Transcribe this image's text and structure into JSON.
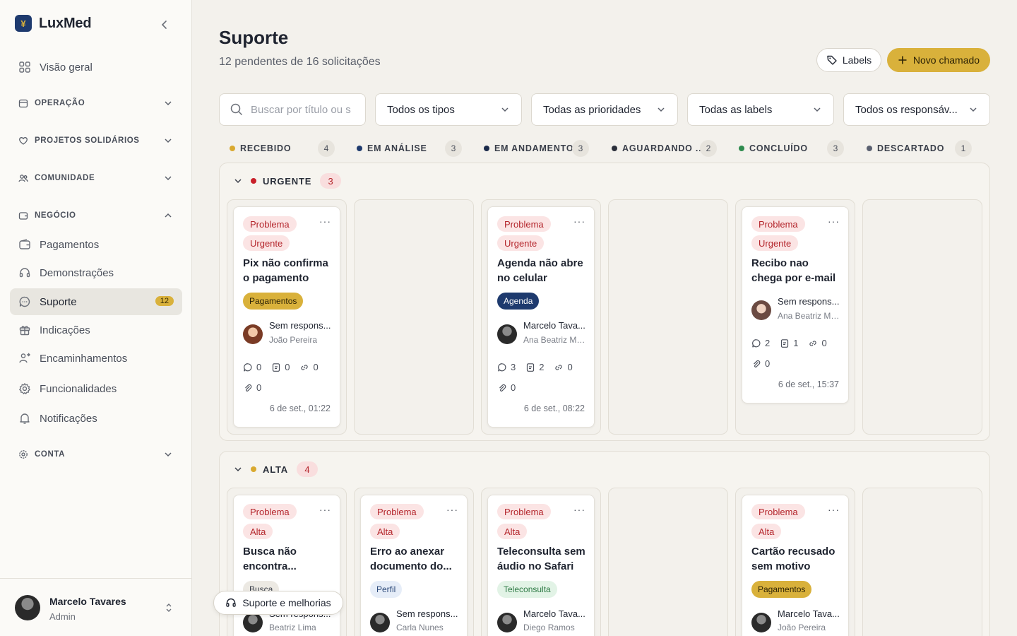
{
  "app": {
    "name": "LuxMed"
  },
  "sidebar": {
    "items": [
      {
        "label": "Visão geral"
      },
      {
        "label": "Pagamentos"
      },
      {
        "label": "Demonstrações"
      },
      {
        "label": "Suporte",
        "badge": "12"
      },
      {
        "label": "Indicações"
      },
      {
        "label": "Encaminhamentos"
      },
      {
        "label": "Funcionalidades"
      },
      {
        "label": "Notificações"
      }
    ],
    "sections": [
      {
        "label": "OPERAÇÃO"
      },
      {
        "label": "PROJETOS SOLIDÁRIOS"
      },
      {
        "label": "COMUNIDADE"
      },
      {
        "label": "NEGÓCIO"
      },
      {
        "label": "CONTA"
      }
    ],
    "user": {
      "name": "Marcelo Tavares",
      "role": "Admin"
    }
  },
  "header": {
    "title": "Suporte",
    "subtitle": "12 pendentes de 16 solicitações",
    "labels_button": "Labels",
    "new_button": "Novo chamado"
  },
  "filters": {
    "search_placeholder": "Buscar por título ou s",
    "type": "Todos os tipos",
    "priority": "Todas as prioridades",
    "labels": "Todas as labels",
    "assignee": "Todos os responsáv..."
  },
  "columns": [
    {
      "label": "RECEBIDO",
      "count": "4",
      "color": "#d9a92f"
    },
    {
      "label": "EM ANÁLISE",
      "count": "3",
      "color": "#1e3a6e"
    },
    {
      "label": "EM ANDAMENTO",
      "count": "3",
      "color": "#1a2a4a"
    },
    {
      "label": "AGUARDANDO ...",
      "count": "2",
      "color": "#2a2f3a"
    },
    {
      "label": "CONCLUÍDO",
      "count": "3",
      "color": "#2e8b4e"
    },
    {
      "label": "DESCARTADO",
      "count": "1",
      "color": "#5a6070"
    }
  ],
  "groups": [
    {
      "label": "URGENTE",
      "count": "3",
      "color": "#c8202a"
    },
    {
      "label": "ALTA",
      "count": "4",
      "color": "#d9a92f"
    }
  ],
  "cards": {
    "u1": {
      "type": "Problema",
      "priority": "Urgente",
      "title1": "Pix não confirma",
      "title2": "o pagamento",
      "label": "Pagamentos",
      "assignee": "Sem respons...",
      "reporter": "João Pereira",
      "comments": "0",
      "docs": "0",
      "links": "0",
      "attachments": "0",
      "date": "6 de set., 01:22"
    },
    "u2": {
      "type": "Problema",
      "priority": "Urgente",
      "title1": "Agenda não abre",
      "title2": "no celular",
      "label": "Agenda",
      "assignee": "Marcelo Tava...",
      "reporter": "Ana Beatriz Mo...",
      "comments": "3",
      "docs": "2",
      "links": "0",
      "attachments": "0",
      "date": "6 de set., 08:22"
    },
    "u3": {
      "type": "Problema",
      "priority": "Urgente",
      "title1": "Recibo nao",
      "title2": "chega por e-mail",
      "assignee": "Sem respons...",
      "reporter": "Ana Beatriz Mo...",
      "comments": "2",
      "docs": "1",
      "links": "0",
      "attachments": "0",
      "date": "6 de set., 15:37"
    },
    "a1": {
      "type": "Problema",
      "priority": "Alta",
      "title1": "Busca não",
      "title2": "encontra...",
      "label": "Busca",
      "assignee": "Sem respons...",
      "reporter": "Beatriz Lima"
    },
    "a2": {
      "type": "Problema",
      "priority": "Alta",
      "title1": "Erro ao anexar",
      "title2": "documento do...",
      "label": "Perfil",
      "assignee": "Sem respons...",
      "reporter": "Carla Nunes"
    },
    "a3": {
      "type": "Problema",
      "priority": "Alta",
      "title1": "Teleconsulta sem",
      "title2": "áudio no Safari",
      "label": "Teleconsulta",
      "assignee": "Marcelo Tava...",
      "reporter": "Diego Ramos"
    },
    "a4": {
      "type": "Problema",
      "priority": "Alta",
      "title1": "Cartão recusado",
      "title2": "sem motivo",
      "label": "Pagamentos",
      "assignee": "Marcelo Tava...",
      "reporter": "João Pereira"
    }
  },
  "floating_button": "Suporte e melhorias",
  "colors": {
    "accent": "#d9b13b",
    "brand": "#1e3a6e",
    "danger": "#b4262c"
  }
}
